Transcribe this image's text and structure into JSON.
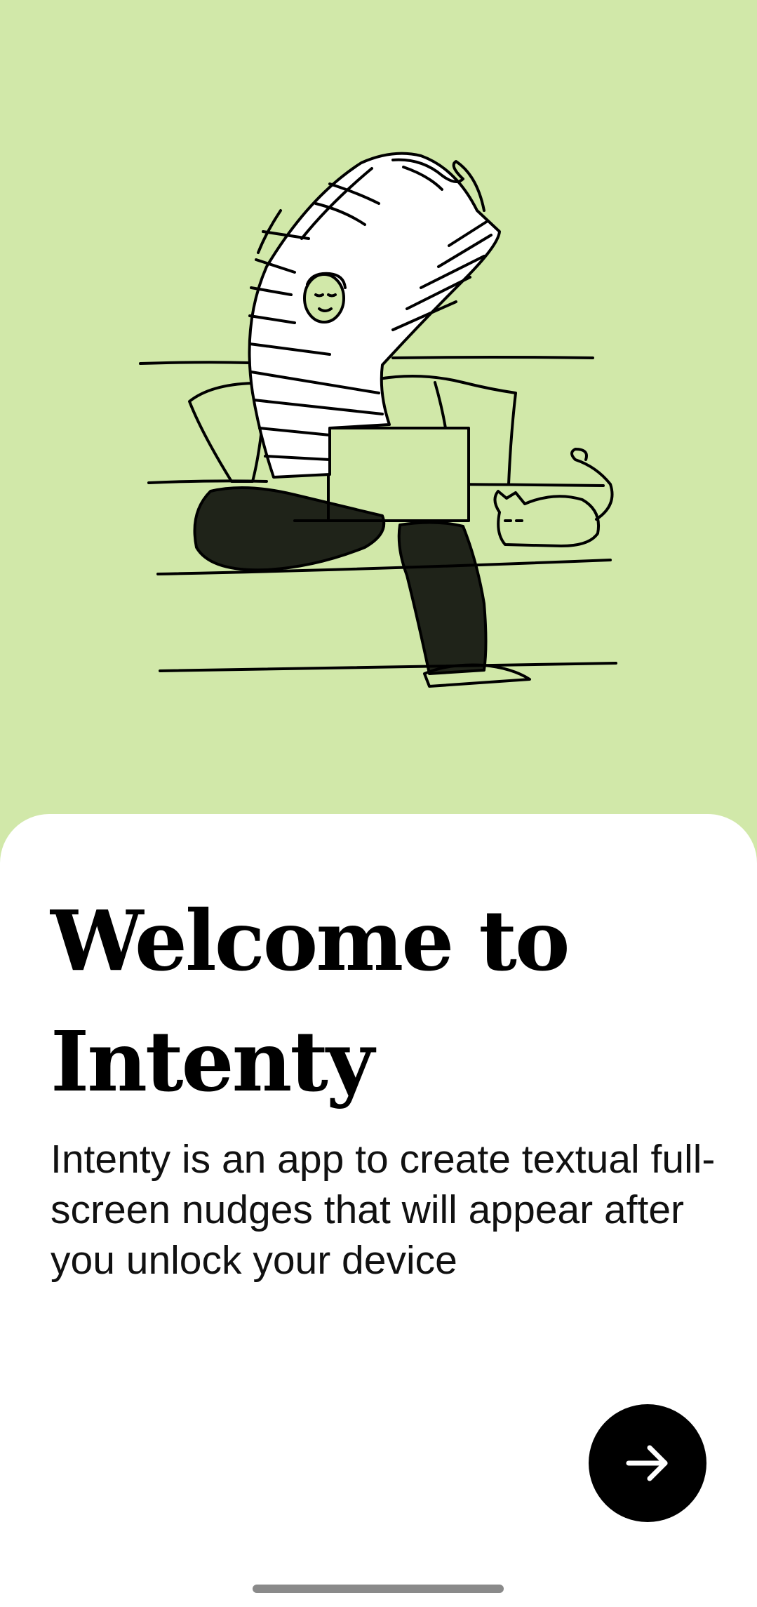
{
  "colors": {
    "hero_background": "#d1e8a9",
    "sheet_background": "#ffffff",
    "button_background": "#000000",
    "text": "#000000"
  },
  "illustration": {
    "subject": "person stretching arms over head on a sofa with a laptop and a cat"
  },
  "welcome": {
    "title_line1": "Welcome to",
    "title_line2": "Intenty",
    "description": "Intenty is an app to create textual full-screen nudges that will appear after you unlock your device"
  },
  "next_button": {
    "icon": "arrow-right-icon"
  }
}
